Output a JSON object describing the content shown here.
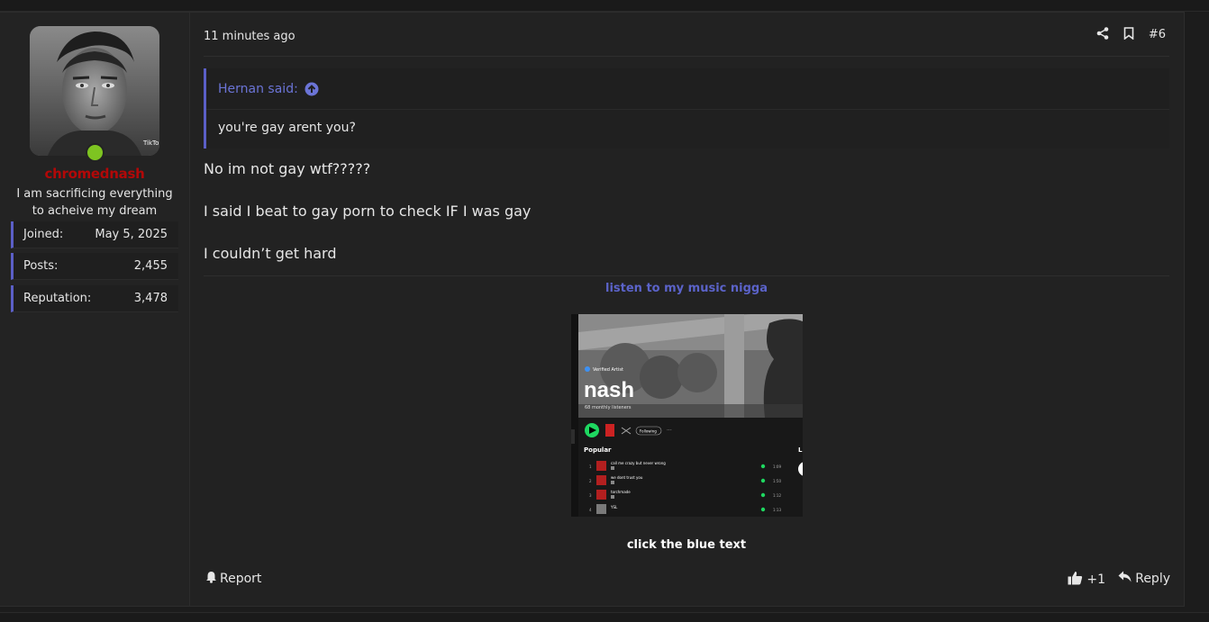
{
  "post": {
    "time": "11 minutes ago",
    "permalink": "#6",
    "quote": {
      "author_label": "Hernan said:",
      "text": "you're gay arent you?"
    },
    "message_lines": [
      "No im not gay wtf?????",
      "I said I beat to gay porn to check IF I was gay",
      "I couldn’t get hard"
    ],
    "signature": {
      "link_text": "listen to my music nigga",
      "caption": "click the blue text",
      "image": {
        "verified_label": "Verified Artist",
        "artist": "nash",
        "listeners": "68 monthly listeners",
        "follow_label": "Following",
        "popular_label": "Popular",
        "side_letter": "L",
        "tracks": [
          {
            "num": "1",
            "title": "call me crazy but never wrong",
            "dur": "1:09"
          },
          {
            "num": "2",
            "title": "we dont trust you",
            "dur": "1:50"
          },
          {
            "num": "3",
            "title": "torchmade",
            "dur": "1:12"
          },
          {
            "num": "4",
            "title": "YSL",
            "dur": "1:13"
          }
        ]
      }
    },
    "footer": {
      "report_label": "Report",
      "reaction_count": "+1",
      "reply_label": "Reply"
    }
  },
  "user": {
    "username": "chromednash",
    "title": "I am sacrificing everything to acheive my dream",
    "avatar_watermark": "TikTok",
    "stats": [
      {
        "key": "Joined:",
        "value": "May 5, 2025"
      },
      {
        "key": "Posts:",
        "value": "2,455"
      },
      {
        "key": "Reputation:",
        "value": "3,478"
      }
    ]
  },
  "colors": {
    "accent": "#5b5fc7",
    "username": "#b20808",
    "online": "#7ec421",
    "link": "#5b63c9"
  }
}
